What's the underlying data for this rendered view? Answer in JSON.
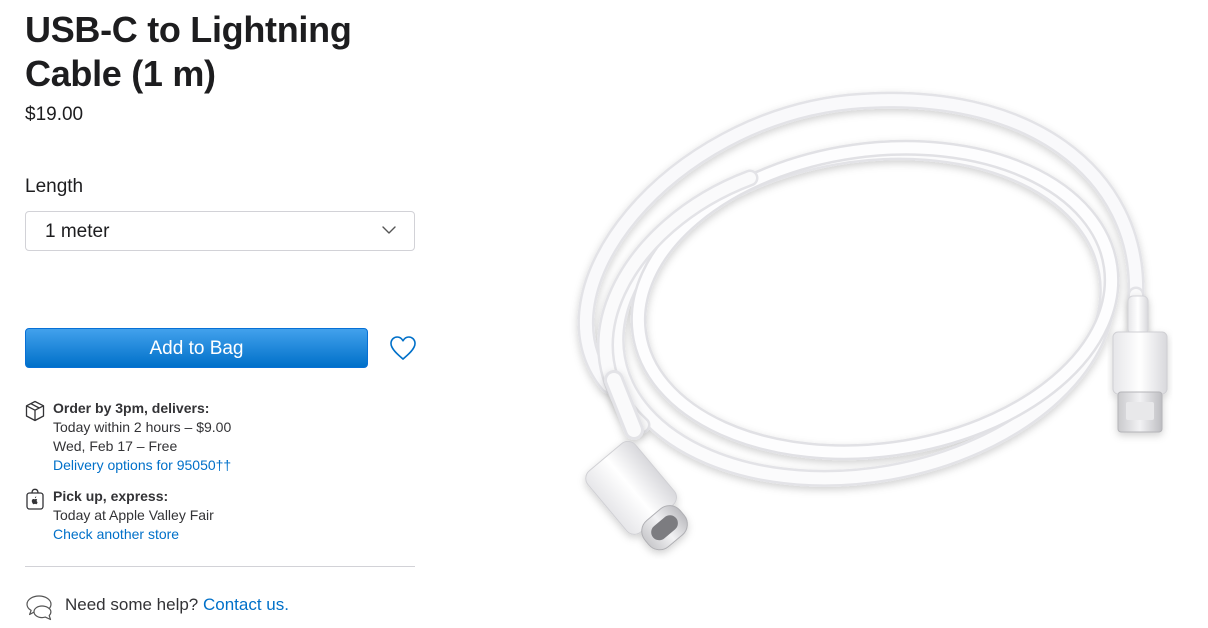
{
  "product": {
    "title_line1": "USB-C to Lightning",
    "title_line2": "Cable (1 m)",
    "price": "$19.00"
  },
  "length": {
    "label": "Length",
    "selected": "1 meter"
  },
  "actions": {
    "add_to_bag": "Add to Bag"
  },
  "delivery": {
    "heading": "Order by 3pm, delivers:",
    "line1": "Today within 2 hours – $9.00",
    "line2": "Wed, Feb 17 – Free",
    "link": "Delivery options for 95050††"
  },
  "pickup": {
    "heading": "Pick up, express:",
    "line1": "Today at Apple Valley Fair",
    "link": "Check another store"
  },
  "help": {
    "prompt": "Need some help?",
    "link": "Contact us."
  },
  "colors": {
    "accent": "#0070c9",
    "button_top": "#42a1ec",
    "button_bottom": "#0070c9",
    "text": "#1d1d1f"
  },
  "icons": {
    "dropdown": "chevron-down-icon",
    "favorite": "heart-icon",
    "delivery": "box-icon",
    "pickup": "shopping-bag-icon",
    "help": "chat-bubbles-icon"
  }
}
